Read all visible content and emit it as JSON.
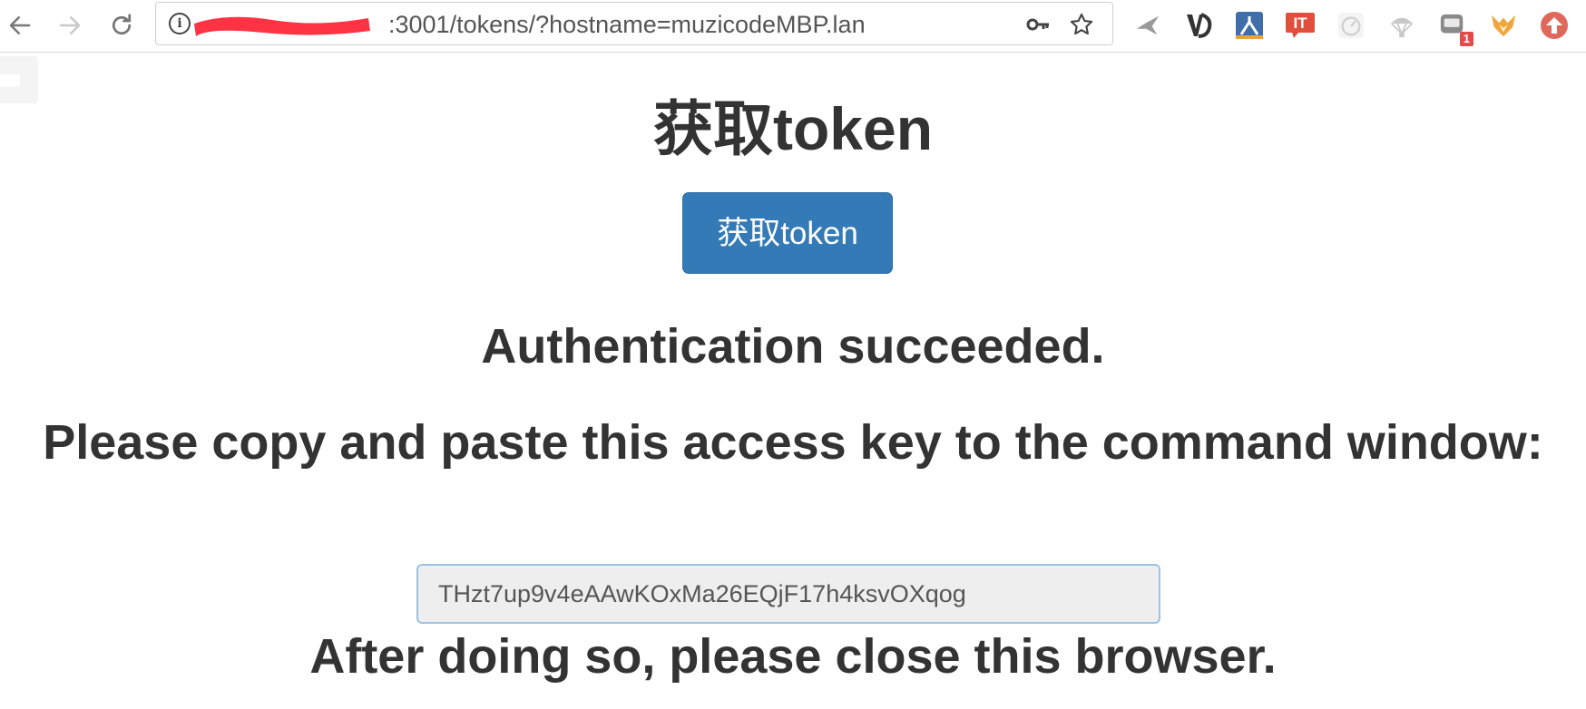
{
  "browser": {
    "url_visible": ":3001/tokens/?hostname=muzicodeMBP.lan",
    "back_icon": "arrow-left-icon",
    "forward_icon": "arrow-right-icon",
    "reload_icon": "reload-icon",
    "key_icon": "key-icon",
    "bookmark_icon": "star-icon",
    "redaction_color": "#ff3344",
    "extensions": [
      {
        "name": "bird-icon"
      },
      {
        "name": "vd-icon"
      },
      {
        "name": "person-icon"
      },
      {
        "name": "it-icon"
      },
      {
        "name": "gauge-icon"
      },
      {
        "name": "parachute-icon"
      },
      {
        "name": "chat-icon",
        "badge": "1"
      },
      {
        "name": "fox-icon"
      },
      {
        "name": "upload-icon"
      }
    ]
  },
  "page": {
    "title": "获取token",
    "button_label": "获取token",
    "success_message": "Authentication succeeded.",
    "copy_instruction": "Please copy and paste this access key to the command window:",
    "token_value": "THzt7up9v4eAAwKOxMa26EQjF17h4ksvOXqog",
    "after_message": "After doing so, please close this browser."
  },
  "colors": {
    "primary_button": "#337ab7",
    "text": "#333333",
    "input_background": "#eeeeee",
    "input_border": "#9ec3e4"
  }
}
